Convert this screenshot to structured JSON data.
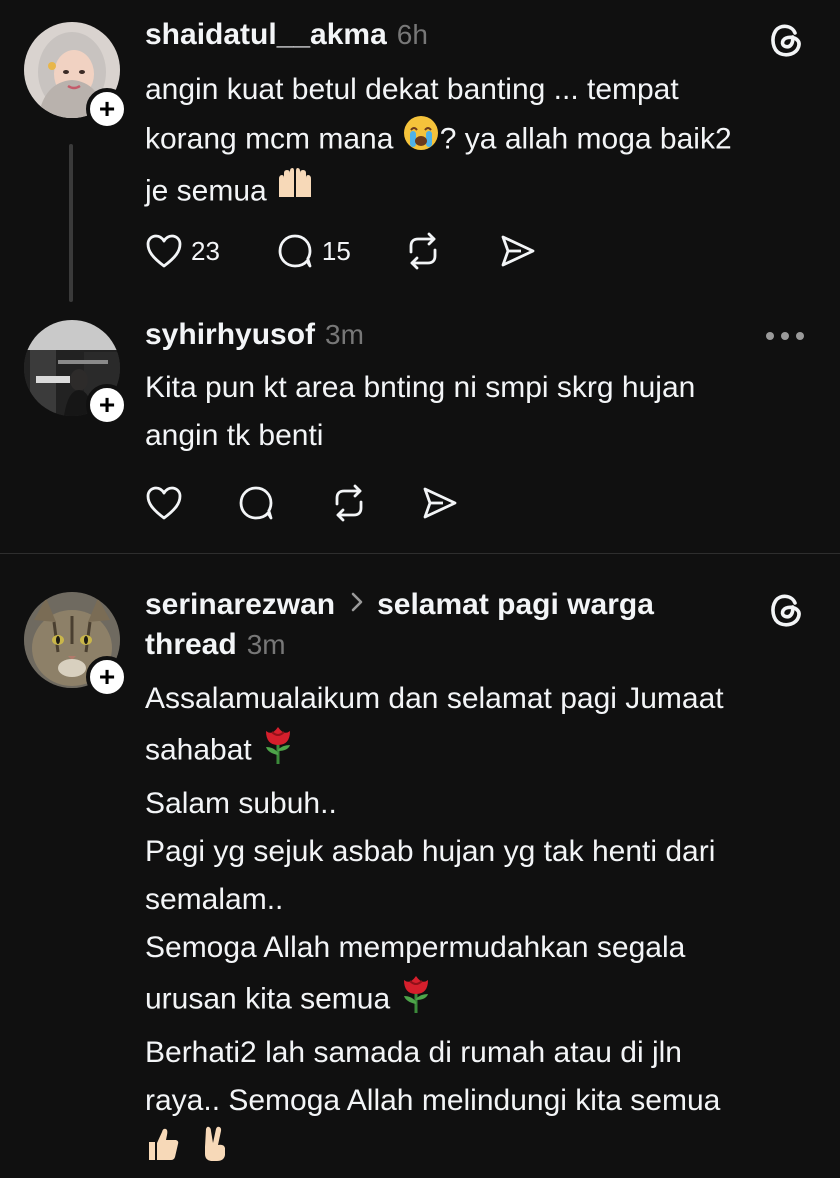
{
  "posts": [
    {
      "username": "shaidatul__akma",
      "time": "6h",
      "text_lines": [
        "angin kuat betul dekat banting ... tempat",
        "korang mcm mana",
        "? ya allah moga baik2",
        "je semua"
      ],
      "likes": "23",
      "replies": "15"
    },
    {
      "username": "syhirhyusof",
      "time": "3m",
      "text_lines": [
        "Kita pun kt area bnting ni smpi skrg hujan",
        "angin tk benti"
      ]
    },
    {
      "username": "serinarezwan",
      "topic": "selamat pagi warga",
      "topic_cont": "thread",
      "time": "3m",
      "lines": [
        "Assalamualaikum dan selamat pagi Jumaat",
        "sahabat",
        "Salam subuh..",
        "Pagi yg sejuk asbab hujan yg tak henti dari",
        "semalam..",
        "Semoga Allah mempermudahkan segala",
        "urusan kita semua",
        "Berhati2 lah samada di rumah atau di jln",
        "raya.. Semoga Allah melindungi kita semua"
      ]
    }
  ],
  "icons": {
    "like": "heart-icon",
    "reply": "comment-icon",
    "repost": "repost-icon",
    "share": "share-icon",
    "brand": "threads-logo-icon",
    "more": "more-icon",
    "follow": "plus-icon"
  },
  "colors": {
    "background": "#101010",
    "text": "#f3f5f7",
    "muted": "#777777",
    "rose": "#d61f2c"
  }
}
